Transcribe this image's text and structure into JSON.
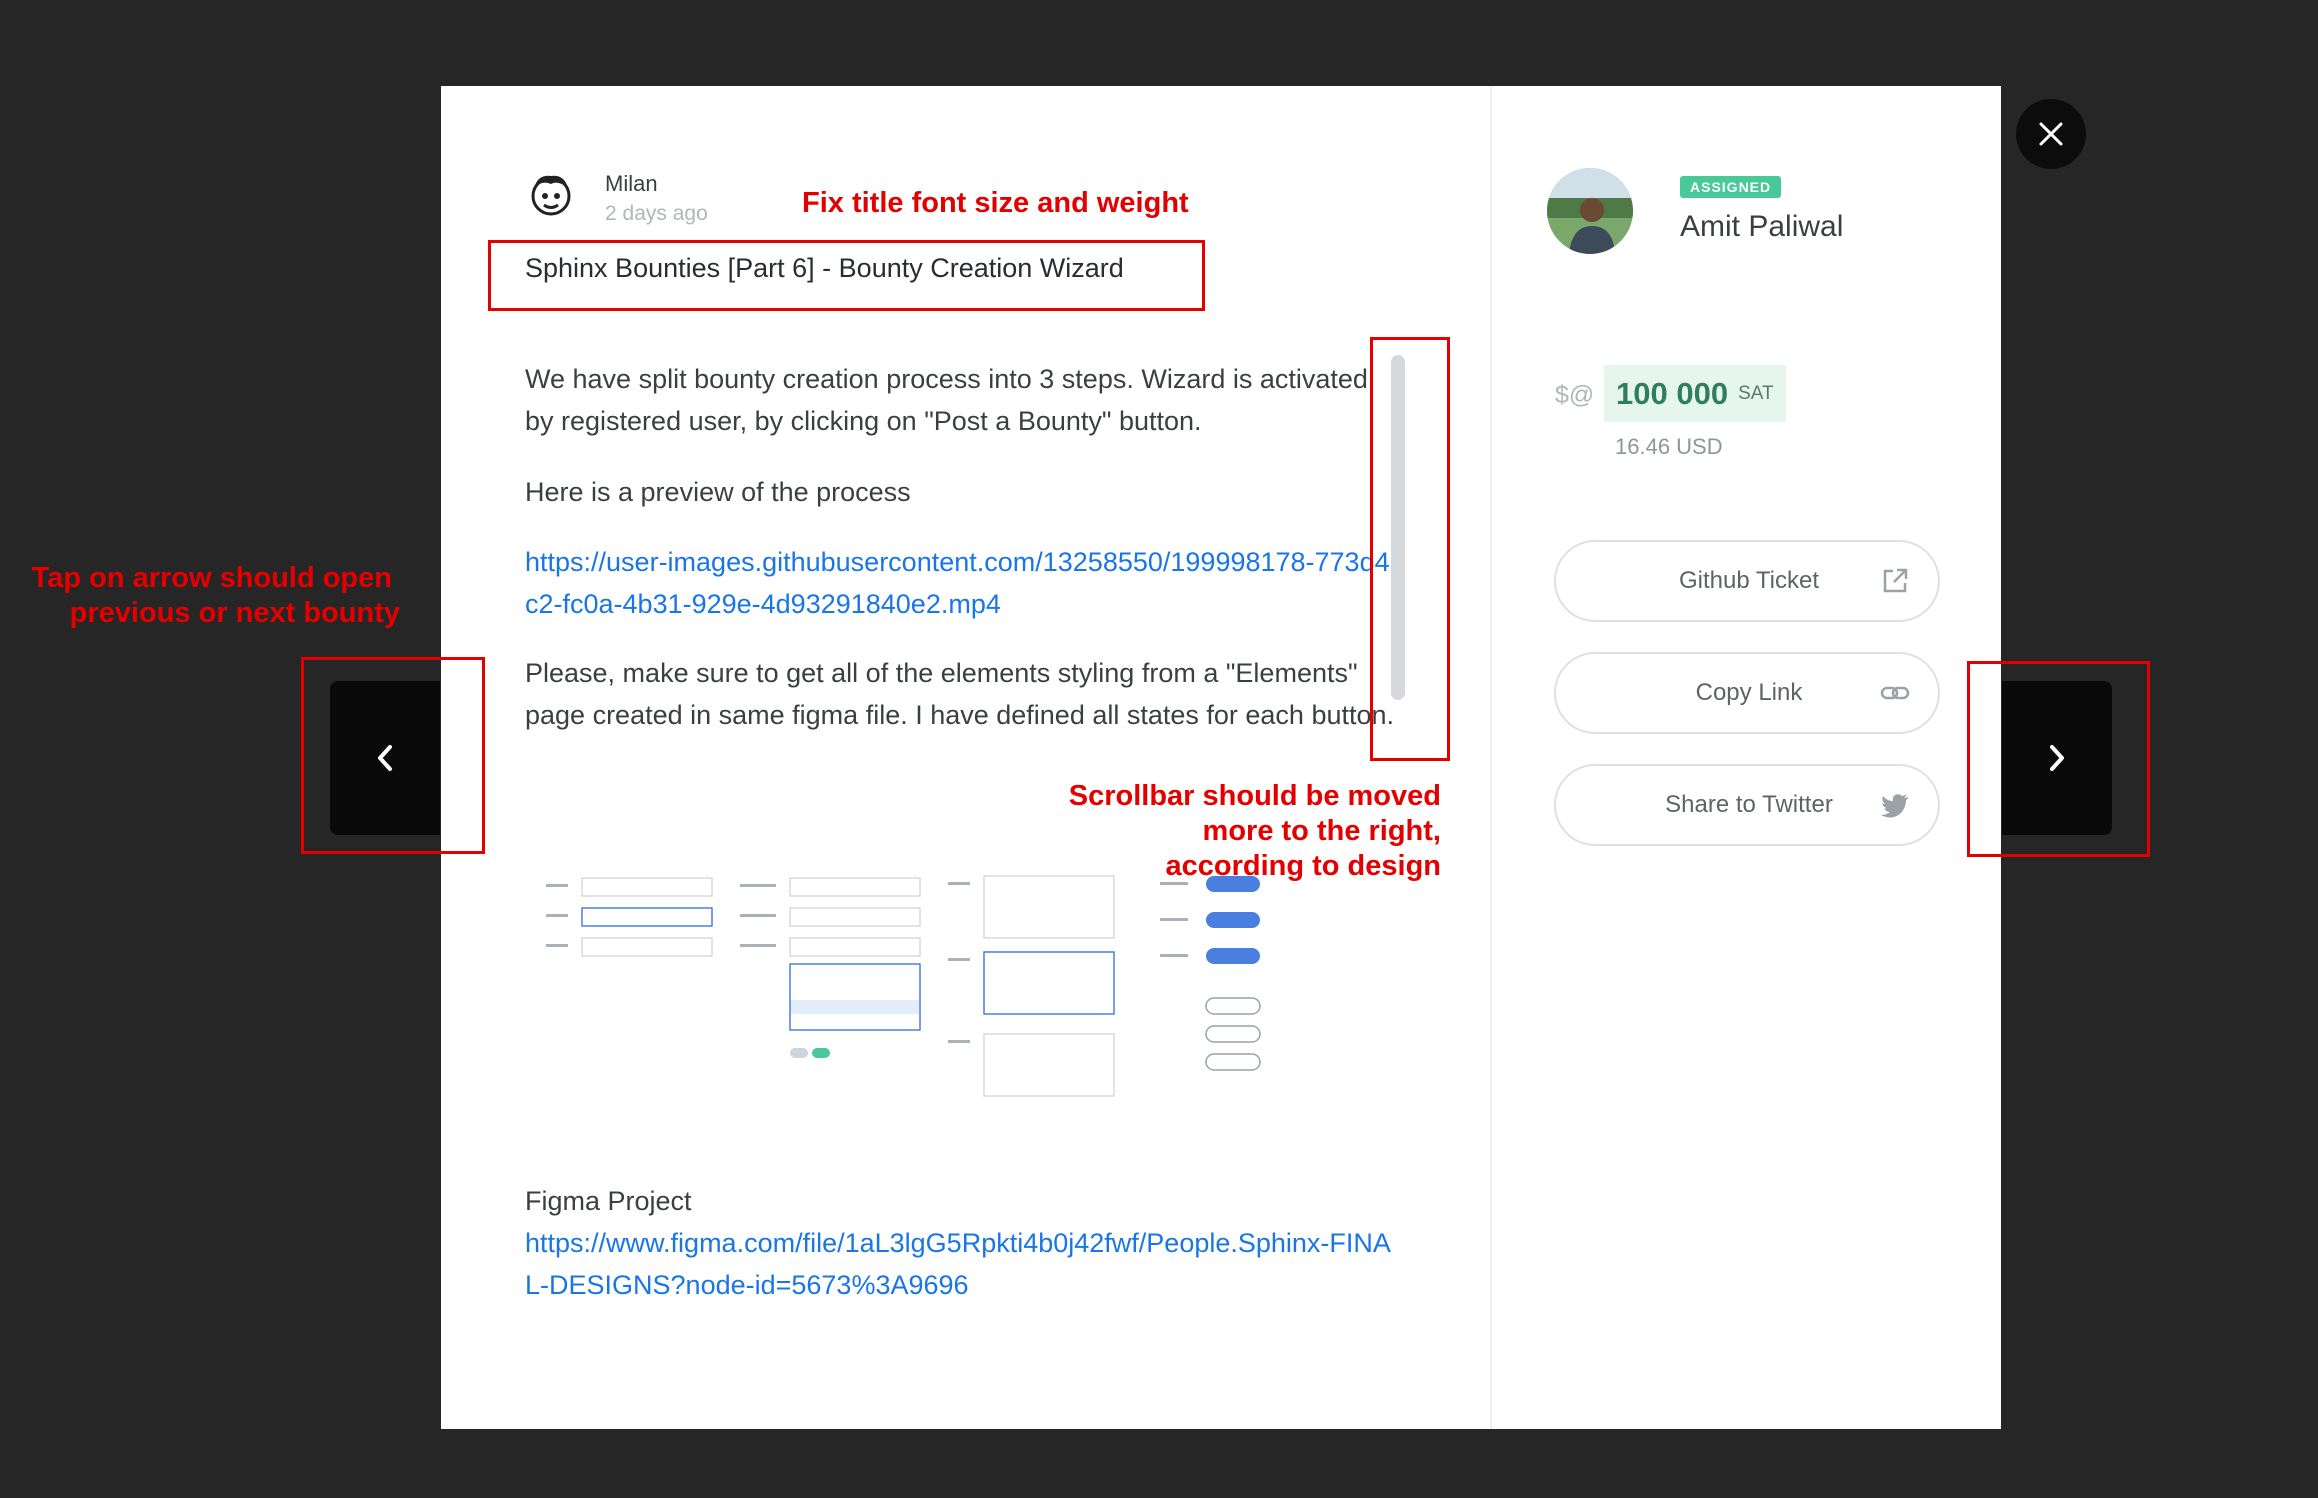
{
  "post": {
    "author": "Milan",
    "time_ago": "2 days ago",
    "title": "Sphinx Bounties [Part 6] - Bounty Creation Wizard",
    "paragraph1": "We have split bounty creation process into 3 steps. Wizard is activated by registered user, by clicking on \"Post a Bounty\" button.",
    "paragraph2": "Here is a preview of the process",
    "link1": "https://user-images.githubusercontent.com/13258550/199998178-773d43c2-fc0a-4b31-929e-4d93291840e2.mp4",
    "paragraph3": "Please, make sure to get all of the elements styling from a \"Elements\" page created in same figma file. I have defined all states for each button.",
    "figma_label": "Figma Project",
    "figma_link": "https://www.figma.com/file/1aL3lgG5Rpkti4b0j42fwf/People.Sphinx-FINAL-DESIGNS?node-id=5673%3A9696"
  },
  "assignee": {
    "badge": "ASSIGNED",
    "name": "Amit Paliwal"
  },
  "price": {
    "symbol": "$@",
    "amount": "100 000",
    "unit": "SAT",
    "usd": "16.46 USD"
  },
  "actions": [
    {
      "label": "Github Ticket",
      "icon": "external-link-icon"
    },
    {
      "label": "Copy Link",
      "icon": "link-icon"
    },
    {
      "label": "Share to Twitter",
      "icon": "twitter-icon"
    }
  ],
  "annotations": {
    "title_note": "Fix  title font size and weight",
    "arrow_note_1": "Tap on arrow should open",
    "arrow_note_2": "previous or next bounty",
    "scroll_note_1": "Scrollbar should be moved",
    "scroll_note_2": "more to the right,",
    "scroll_note_3": "according to design"
  },
  "colors": {
    "accent_link": "#1a76e6",
    "badge": "#49c998",
    "annotation": "#e50000"
  }
}
